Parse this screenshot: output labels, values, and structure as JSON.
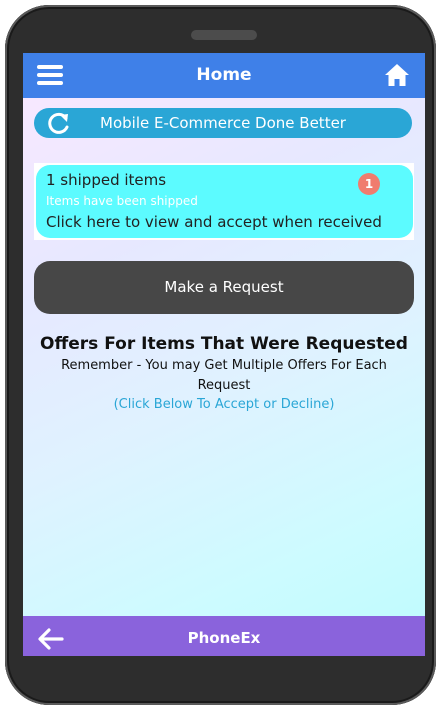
{
  "header": {
    "title": "Home",
    "menu_icon": "hamburger-menu-icon",
    "home_icon": "home-icon",
    "color": "#3f80e8"
  },
  "banner": {
    "icon": "refresh-icon",
    "label": "Mobile E-Commerce Done Better",
    "color": "#2aa6d6"
  },
  "shipped": {
    "title": "1 shipped items",
    "subtitle": "Items have been shipped",
    "action": "Click here to view and accept when received",
    "badge_count": "1",
    "color": "#5cfbff"
  },
  "request_button": {
    "label": "Make a Request"
  },
  "offers": {
    "title": "Offers For Items That Were Requested",
    "subtitle": "Remember - You may Get Multiple Offers For Each Request",
    "hint": "(Click Below To Accept or Decline)"
  },
  "footer": {
    "app_name": "PhoneEx",
    "back_icon": "back-arrow-icon",
    "color": "#8a63dc"
  }
}
